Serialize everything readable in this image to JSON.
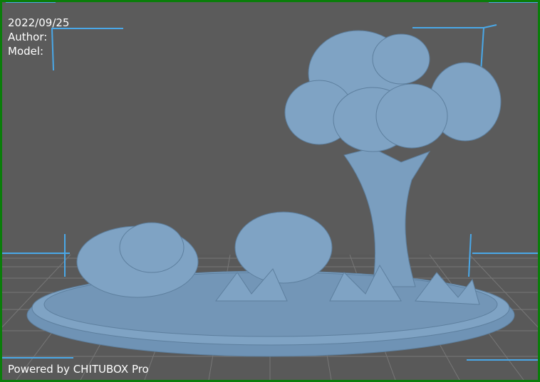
{
  "overlay": {
    "date": "2022/09/25",
    "author_label": "Author:",
    "model_label": "Model:"
  },
  "footer": {
    "powered_by": "Powered by CHITUBOX Pro"
  },
  "colors": {
    "border": "#0a7d0a",
    "background": "#5b5b5b",
    "model": "#7fa3c4",
    "axis": "#4aa8e8",
    "grid": "#6e6e6e"
  }
}
